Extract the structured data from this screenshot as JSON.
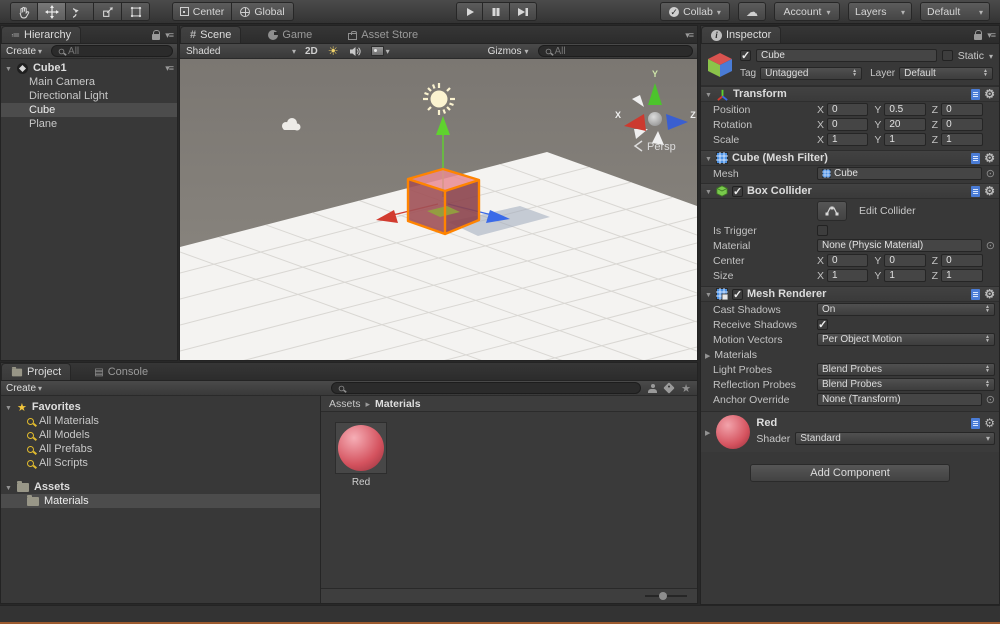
{
  "toolbar": {
    "pivot_label": "Center",
    "space_label": "Global",
    "collab_label": "Collab",
    "account_label": "Account",
    "layers_label": "Layers",
    "layout_label": "Default"
  },
  "hierarchy": {
    "tab": "Hierarchy",
    "create_label": "Create",
    "search_placeholder": "All",
    "root": "Cube1",
    "items": [
      "Main Camera",
      "Directional Light",
      "Cube",
      "Plane"
    ]
  },
  "scene_view": {
    "tab_scene": "Scene",
    "tab_game": "Game",
    "tab_asset_store": "Asset Store",
    "shading": "Shaded",
    "mode_2d": "2D",
    "gizmos_label": "Gizmos",
    "search_placeholder": "All",
    "persp_label": "Persp",
    "axis": {
      "x": "X",
      "y": "Y",
      "z": "Z"
    }
  },
  "inspector": {
    "tab": "Inspector",
    "header": {
      "name": "Cube",
      "static_label": "Static",
      "tag_label": "Tag",
      "tag_value": "Untagged",
      "layer_label": "Layer",
      "layer_value": "Default"
    },
    "axis": {
      "x": "X",
      "y": "Y",
      "z": "Z"
    },
    "transform": {
      "title": "Transform",
      "position_label": "Position",
      "position": {
        "x": "0",
        "y": "0.5",
        "z": "0"
      },
      "rotation_label": "Rotation",
      "rotation": {
        "x": "0",
        "y": "20",
        "z": "0"
      },
      "scale_label": "Scale",
      "scale": {
        "x": "1",
        "y": "1",
        "z": "1"
      }
    },
    "mesh_filter": {
      "title": "Cube (Mesh Filter)",
      "mesh_label": "Mesh",
      "mesh_value": "Cube"
    },
    "box_collider": {
      "title": "Box Collider",
      "edit_collider_label": "Edit Collider",
      "is_trigger_label": "Is Trigger",
      "material_label": "Material",
      "material_value": "None (Physic Material)",
      "center_label": "Center",
      "center": {
        "x": "0",
        "y": "0",
        "z": "0"
      },
      "size_label": "Size",
      "size": {
        "x": "1",
        "y": "1",
        "z": "1"
      }
    },
    "mesh_renderer": {
      "title": "Mesh Renderer",
      "cast_shadows_label": "Cast Shadows",
      "cast_shadows_value": "On",
      "receive_shadows_label": "Receive Shadows",
      "motion_vectors_label": "Motion Vectors",
      "motion_vectors_value": "Per Object Motion",
      "materials_label": "Materials",
      "light_probes_label": "Light Probes",
      "light_probes_value": "Blend Probes",
      "reflection_probes_label": "Reflection Probes",
      "reflection_probes_value": "Blend Probes",
      "anchor_override_label": "Anchor Override",
      "anchor_override_value": "None (Transform)"
    },
    "material": {
      "name": "Red",
      "shader_label": "Shader",
      "shader_value": "Standard"
    },
    "add_component_label": "Add Component"
  },
  "project": {
    "tab_project": "Project",
    "tab_console": "Console",
    "create_label": "Create",
    "favorites_label": "Favorites",
    "favorites": [
      "All Materials",
      "All Models",
      "All Prefabs",
      "All Scripts"
    ],
    "assets_label": "Assets",
    "folders": [
      "Materials"
    ],
    "breadcrumb": {
      "root": "Assets",
      "current": "Materials"
    },
    "items": [
      {
        "name": "Red"
      }
    ]
  },
  "colors": {
    "selection": "#4c4c4c",
    "selection_outline": "#ff8400",
    "material_red": "#d9616f",
    "gizmo_x": "#d23b2f",
    "gizmo_y": "#5fd22e",
    "gizmo_z": "#3a6ae8"
  }
}
